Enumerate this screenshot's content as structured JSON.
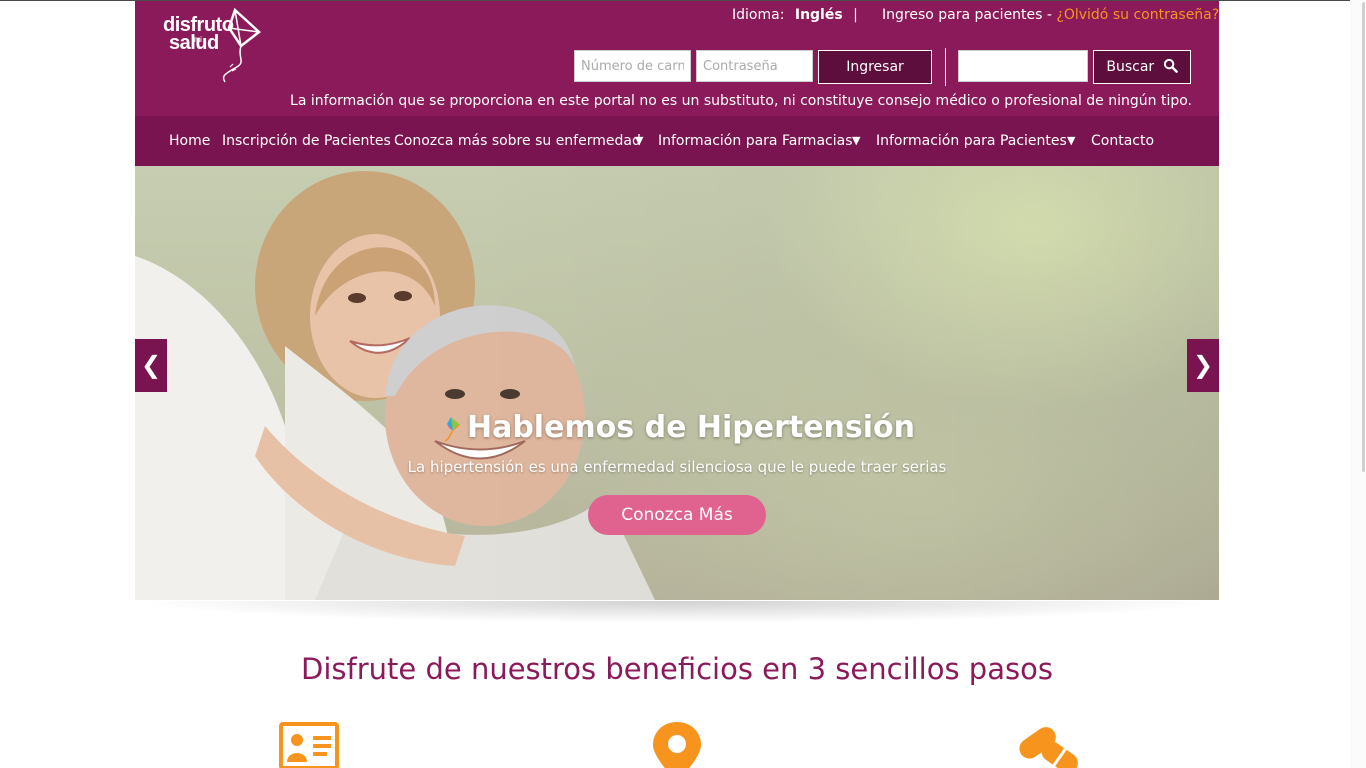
{
  "brand": {
    "logo_text_line1": "disfruto",
    "logo_text_mi": "mi",
    "logo_text_line2": "salud",
    "primary_color": "#8b1a5a",
    "nav_color": "#7a1450",
    "accent_color": "#f7941d",
    "button_color": "#e0628f"
  },
  "header": {
    "language_label": "Idioma:",
    "language_value": "Inglés",
    "language_separator": "|",
    "patient_login_label": "Ingreso para pacientes -",
    "forgot_password_link": "¿Olvidó su contraseña?",
    "card_number_placeholder": "Número de carne",
    "password_placeholder": "Contraseña",
    "login_button": "Ingresar",
    "search_value": "",
    "search_button": "Buscar",
    "search_icon": "search-icon",
    "disclaimer": "La información que se proporciona en este portal no es un substituto, ni constituye consejo médico o profesional de ningún tipo."
  },
  "nav": {
    "items": [
      {
        "label": "Home"
      },
      {
        "label": "Inscripción de Pacientes"
      },
      {
        "label": "Conozca más sobre su enfermedad",
        "dropdown": true
      },
      {
        "label": "Información para Farmacias",
        "dropdown": true
      },
      {
        "label": "Información para Pacientes",
        "dropdown": true
      },
      {
        "label": "Contacto"
      }
    ],
    "caret": "▼"
  },
  "hero": {
    "title": "Hablemos de Hipertensión",
    "subtitle": "La hipertensión es una enfermedad silenciosa que le puede traer serias",
    "cta": "Conozca Más",
    "prev_arrow": "❮",
    "next_arrow": "❯"
  },
  "steps": {
    "title": "Disfrute de nuestros beneficios en 3 sencillos pasos",
    "icons": [
      "id-card-icon",
      "location-pin-icon",
      "pills-icon"
    ],
    "icon_color": "#f7941d"
  }
}
